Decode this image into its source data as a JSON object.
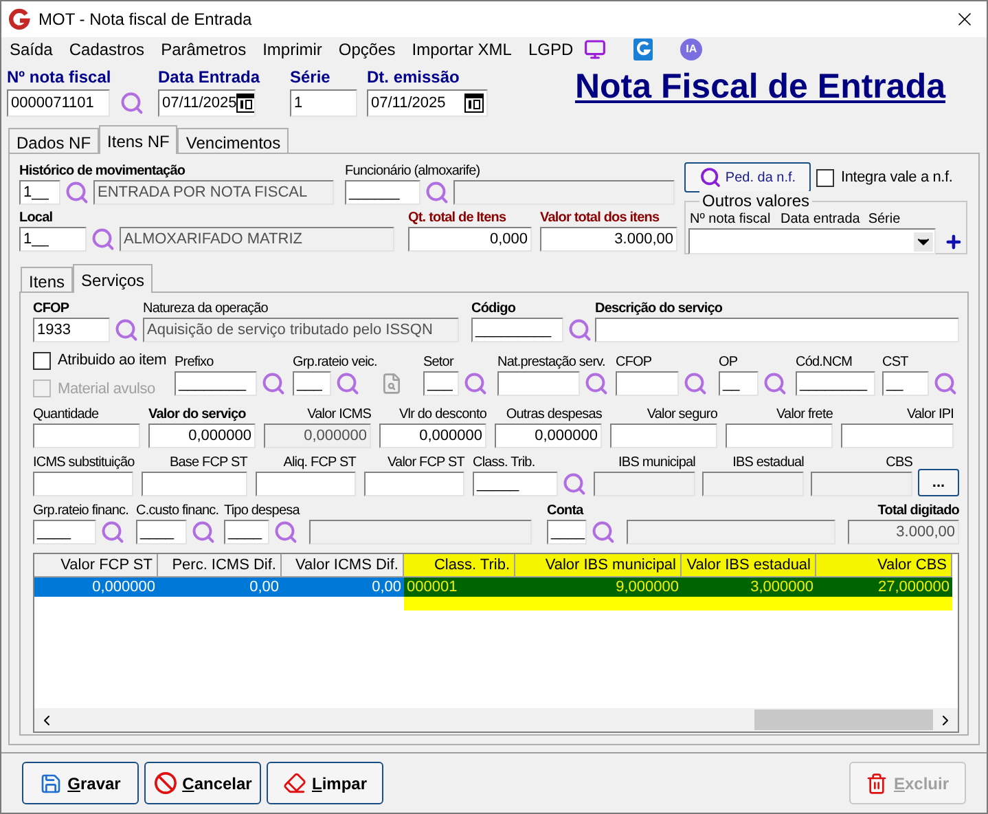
{
  "window": {
    "title": "MOT - Nota fiscal de Entrada"
  },
  "menu": {
    "items": [
      "Saída",
      "Cadastros",
      "Parâmetros",
      "Imprimir",
      "Opções",
      "Importar XML",
      "LGPD"
    ],
    "assistant_badge": "IA"
  },
  "header": {
    "fields": [
      {
        "label": "Nº nota fiscal",
        "value": "0000071101",
        "kind": "lookup"
      },
      {
        "label": "Data Entrada",
        "value": "07/11/2025",
        "kind": "date"
      },
      {
        "label": "Série",
        "value": "1",
        "kind": "text"
      },
      {
        "label": "Dt. emissão",
        "value": "07/11/2025",
        "kind": "date"
      }
    ],
    "title": "Nota Fiscal de Entrada"
  },
  "tabs": [
    {
      "label": "Dados NF",
      "selected": false
    },
    {
      "label": "Itens NF",
      "selected": true
    },
    {
      "label": "Vencimentos",
      "selected": false
    }
  ],
  "movement": [
    {
      "label": "Histórico de movimentação",
      "value": "1__",
      "description": "ENTRADA POR NOTA FISCAL",
      "kind": "lookup_desc",
      "bold": true,
      "alert": false
    },
    {
      "label": "Funcionário (almoxarife)",
      "value": "______",
      "kind": "lookup_desc",
      "bold": false,
      "alert": false
    }
  ],
  "order_button": "Ped. da n.f.",
  "integra": {
    "label": "Integra vale a n.f.",
    "checked": false
  },
  "local_row": [
    {
      "label": "Local",
      "value": "1__",
      "description": "ALMOXARIFADO MATRIZ",
      "kind": "lookup_desc",
      "bold": true,
      "alert": false
    },
    {
      "label": "Qt. total de Itens",
      "value": "0,000",
      "kind": "text",
      "bold": true,
      "alert": true
    },
    {
      "label": "Valor total dos itens",
      "value": "3.000,00",
      "kind": "text",
      "bold": true,
      "alert": true
    }
  ],
  "outros_valores": {
    "title": "Outros valores",
    "columns": [
      "Nº nota fiscal",
      "Data entrada",
      "Série"
    ]
  },
  "inner_tabs": [
    {
      "label": "Itens",
      "selected": false
    },
    {
      "label": "Serviços",
      "selected": true
    }
  ],
  "servicos": {
    "row_1": [
      {
        "label": "CFOP",
        "value": "1933",
        "kind": "lookup",
        "bold": true,
        "alert": false
      },
      {
        "label": "Natureza da operação",
        "value": "Aquisição de serviço tributado pelo ISSQN",
        "kind": "readonly",
        "bold": false,
        "alert": false
      },
      {
        "label": "Código",
        "value": "_________",
        "kind": "lookup",
        "bold": true,
        "alert": false
      },
      {
        "label": "Descrição do serviço",
        "kind": "text",
        "bold": true,
        "alert": false
      }
    ],
    "options": [
      {
        "label": "Atribuido ao item",
        "checked": false,
        "disabled": false
      },
      {
        "label": "Material avulso",
        "checked": false,
        "disabled": true
      }
    ],
    "row_2": [
      {
        "label": "Prefixo",
        "value": "________",
        "kind": "lookup",
        "bold": false,
        "alert": false
      },
      {
        "label": "Grp.rateio veic.",
        "value": "___",
        "kind": "lookup",
        "bold": false,
        "alert": false
      },
      {
        "label": "Setor",
        "value": "___",
        "kind": "lookup",
        "bold": false,
        "alert": false
      },
      {
        "label": "Nat.prestação serv.",
        "kind": "lookup",
        "bold": false,
        "alert": false
      },
      {
        "label": "CFOP",
        "kind": "lookup",
        "bold": false,
        "alert": false
      },
      {
        "label": "OP",
        "value": "__",
        "kind": "lookup",
        "bold": false,
        "alert": false
      },
      {
        "label": "Cód.NCM",
        "value": "________",
        "kind": "text",
        "bold": false,
        "alert": false
      },
      {
        "label": "CST",
        "value": "__",
        "kind": "lookup",
        "bold": false,
        "alert": false
      }
    ],
    "row_3": [
      {
        "label": "Quantidade",
        "kind": "text",
        "bold": false,
        "alert": false
      },
      {
        "label": "Valor do serviço",
        "value": "0,000000",
        "kind": "text",
        "bold": true,
        "alert": false
      },
      {
        "label": "Valor ICMS",
        "value": "0,000000",
        "kind": "readonly",
        "bold": false,
        "alert": false
      },
      {
        "label": "Vlr do desconto",
        "value": "0,000000",
        "kind": "text",
        "bold": false,
        "alert": false
      },
      {
        "label": "Outras despesas",
        "value": "0,000000",
        "kind": "text",
        "bold": false,
        "alert": false
      },
      {
        "label": "Valor seguro",
        "kind": "text",
        "bold": false,
        "alert": false
      },
      {
        "label": "Valor frete",
        "kind": "text",
        "bold": false,
        "alert": false
      },
      {
        "label": "Valor IPI",
        "kind": "text",
        "bold": false,
        "alert": false
      }
    ],
    "row_4": [
      {
        "label": "ICMS substituição",
        "kind": "text",
        "bold": false,
        "alert": false
      },
      {
        "label": "Base FCP ST",
        "kind": "text",
        "bold": false,
        "alert": false
      },
      {
        "label": "Aliq. FCP ST",
        "kind": "text",
        "bold": false,
        "alert": false
      },
      {
        "label": "Valor FCP ST",
        "kind": "text",
        "bold": false,
        "alert": false
      },
      {
        "label": "Class. Trib.",
        "value": "_____",
        "kind": "lookup",
        "bold": false,
        "alert": false
      },
      {
        "label": "IBS municipal",
        "kind": "readonly",
        "bold": false,
        "alert": false
      },
      {
        "label": "IBS estadual",
        "kind": "readonly",
        "bold": false,
        "alert": false
      },
      {
        "label": "CBS",
        "kind": "readonly",
        "bold": false,
        "alert": false
      },
      {
        "label": "...",
        "kind": "button",
        "bold": true,
        "alert": false
      }
    ],
    "row_5": [
      {
        "label": "Grp.rateio financ.",
        "value": "____",
        "kind": "lookup",
        "bold": false,
        "alert": false
      },
      {
        "label": "C.custo financ.",
        "value": "____",
        "kind": "lookup",
        "bold": false,
        "alert": false
      },
      {
        "label": "Tipo despesa",
        "value": "____",
        "kind": "lookup",
        "bold": false,
        "alert": false
      },
      {
        "kind": "readonly"
      },
      {
        "label": "Conta",
        "value": "____",
        "kind": "lookup",
        "bold": true,
        "alert": false
      },
      {
        "kind": "readonly"
      },
      {
        "label": "Total digitado",
        "value": "3.000,00",
        "kind": "readonly",
        "bold": true,
        "alert": false
      }
    ]
  },
  "grid": {
    "columns": [
      {
        "label": "Valor FCP ST",
        "highlighted": false
      },
      {
        "label": "Perc. ICMS Dif.",
        "highlighted": false
      },
      {
        "label": "Valor ICMS Dif.",
        "highlighted": false
      },
      {
        "label": "Class. Trib.",
        "highlighted": true
      },
      {
        "label": "Valor IBS municipal",
        "highlighted": true
      },
      {
        "label": "Valor IBS estadual",
        "highlighted": true
      },
      {
        "label": "Valor CBS",
        "highlighted": true
      }
    ],
    "rows": [
      {
        "selected": true,
        "cells": [
          "0,000000",
          "0,00",
          "0,00",
          "000001",
          "9,000000",
          "3,000000",
          "27,000000"
        ]
      }
    ]
  },
  "buttons": [
    {
      "label": "Gravar",
      "kind": "save",
      "disabled": false
    },
    {
      "label": "Cancelar",
      "kind": "cancel",
      "disabled": false
    },
    {
      "label": "Limpar",
      "kind": "clear",
      "disabled": false
    },
    {
      "label": "Excluir",
      "kind": "delete",
      "disabled": true
    }
  ]
}
